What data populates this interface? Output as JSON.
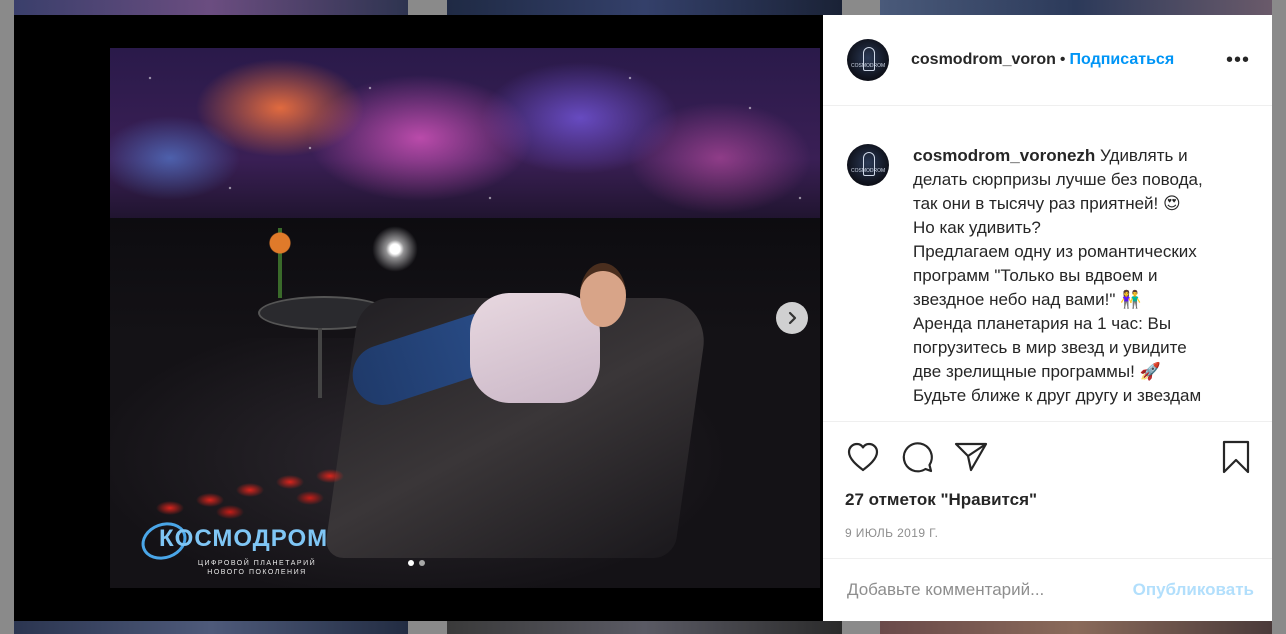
{
  "post": {
    "username": "cosmodrom_voronezh",
    "header_username": "cosmodrom_voron",
    "separator": "•",
    "follow_label": "Подписаться",
    "more_label": "•••",
    "caption_lines": [
      "Удивлять и",
      "делать сюрпризы лучше без повода,",
      "так они в тысячу раз приятней! 😍",
      "Но как удивить?",
      "Предлагаем одну из романтических",
      "программ \"Только вы вдвоем и",
      "звездное небо над вами!\" 👫",
      "Аренда планетария на 1 час: Вы",
      "погрузитесь в мир звезд и увидите",
      "две зрелищные программы! 🚀",
      "Будьте ближе к друг другу и звездам"
    ],
    "likes_text": "27 отметок \"Нравится\"",
    "date_text": "9 ИЮЛЬ 2019 Г.",
    "comment_placeholder": "Добавьте комментарий...",
    "publish_label": "Опубликовать",
    "avatar_text": "COSMODROM"
  },
  "media": {
    "logo_word": "КОСМОДРОМ",
    "logo_sub": "ЦИФРОВОЙ ПЛАНЕТАРИЙ\nНОВОГО ПОКОЛЕНИЯ",
    "carousel_count": 2,
    "carousel_active_index": 0
  },
  "icons": {
    "like": "heart-icon",
    "comment": "comment-bubble-icon",
    "share": "paper-plane-icon",
    "save": "bookmark-icon",
    "next": "chevron-right-icon"
  },
  "colors": {
    "link_blue": "#0095f6",
    "publish_disabled": "#b2dffc",
    "text": "#262626",
    "muted": "#8e8e8e"
  }
}
